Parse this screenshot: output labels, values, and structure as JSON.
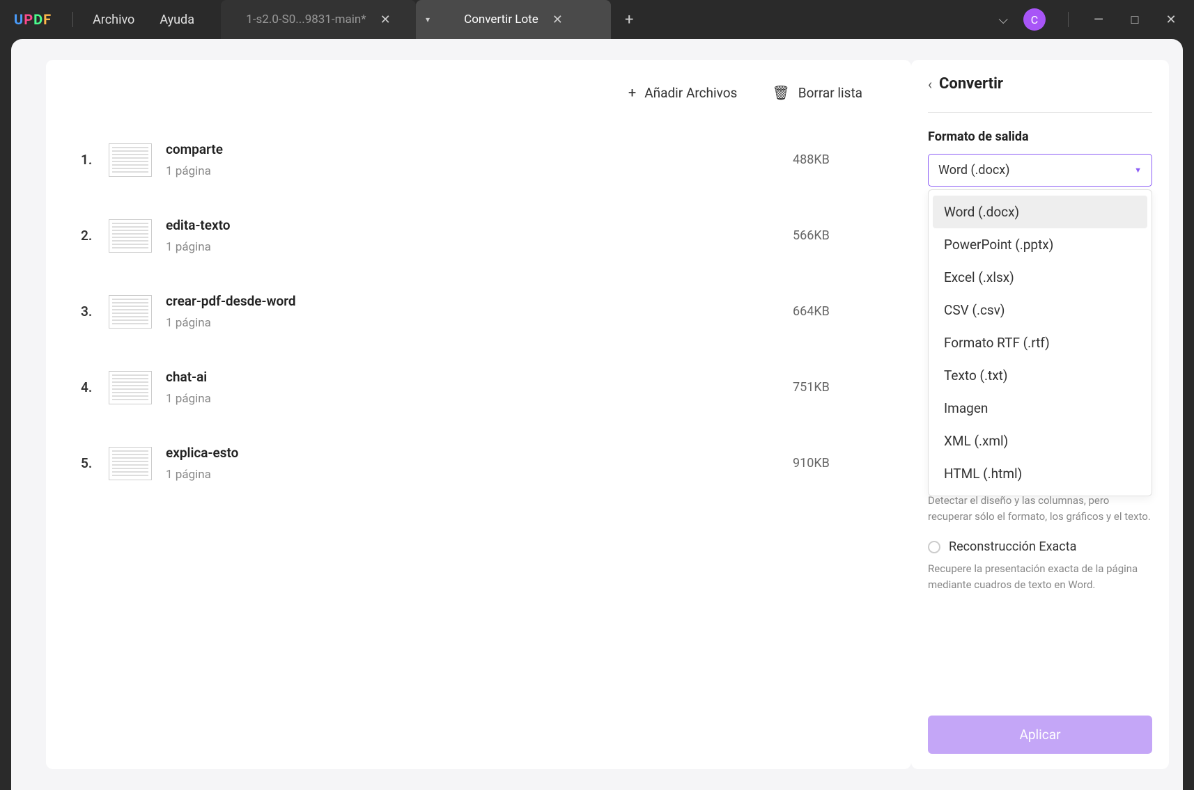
{
  "titlebar": {
    "menus": {
      "file": "Archivo",
      "help": "Ayuda"
    },
    "tabs": [
      {
        "label": "1-s2.0-S0...9831-main*",
        "active": false
      },
      {
        "label": "Convertir Lote",
        "active": true
      }
    ],
    "avatar_initial": "C"
  },
  "main": {
    "add_files": "Añadir Archivos",
    "clear_list": "Borrar lista",
    "files": [
      {
        "num": "1.",
        "name": "comparte",
        "meta": "1 página",
        "size": "488KB"
      },
      {
        "num": "2.",
        "name": "edita-texto",
        "meta": "1 página",
        "size": "566KB"
      },
      {
        "num": "3.",
        "name": "crear-pdf-desde-word",
        "meta": "1 página",
        "size": "664KB"
      },
      {
        "num": "4.",
        "name": "chat-ai",
        "meta": "1 página",
        "size": "751KB"
      },
      {
        "num": "5.",
        "name": "explica-esto",
        "meta": "1 página",
        "size": "910KB"
      }
    ]
  },
  "sidebar": {
    "title": "Convertir",
    "output_format_label": "Formato de salida",
    "selected_format": "Word (.docx)",
    "format_options": [
      "Word (.docx)",
      "PowerPoint (.pptx)",
      "Excel (.xlsx)",
      "CSV (.csv)",
      "Formato RTF (.rtf)",
      "Texto (.txt)",
      "Imagen",
      "XML (.xml)",
      "HTML (.html)"
    ],
    "hint1": "Detectar el diseño y las columnas, pero recuperar sólo el formato, los gráficos y el texto.",
    "radio2_label": "Reconstrucción Exacta",
    "hint2": "Recupere la presentación exacta de la página mediante cuadros de texto en Word.",
    "apply": "Aplicar"
  }
}
